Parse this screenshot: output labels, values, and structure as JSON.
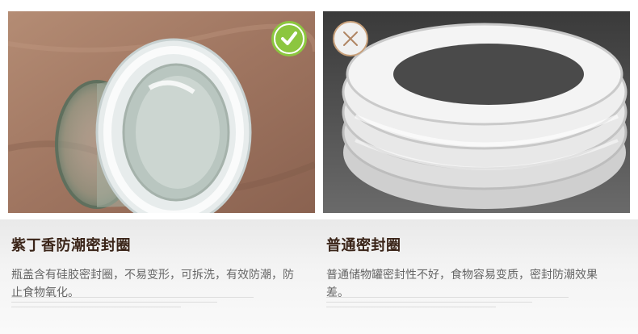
{
  "panels": [
    {
      "badge_icon": "checkmark-icon",
      "badge_color": "#8cc63f",
      "title": "紫丁香防潮密封圈",
      "body": "瓶盖含有硅胶密封圈，不易变形，可拆洗，有效防潮，防止食物氧化。"
    },
    {
      "badge_icon": "cross-icon",
      "badge_color": "#c8a07a",
      "title": "普通密封圈",
      "body": "普通储物罐密封性不好，食物容易变质，密封防潮效果差。"
    }
  ]
}
